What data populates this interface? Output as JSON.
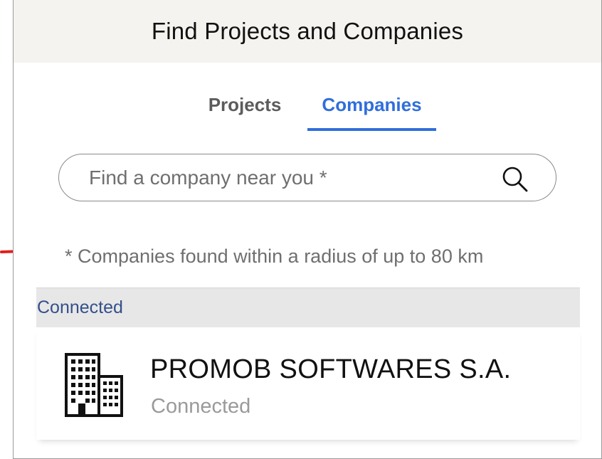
{
  "header": {
    "title": "Find Projects and Companies"
  },
  "tabs": [
    {
      "label": "Projects",
      "active": false
    },
    {
      "label": "Companies",
      "active": true
    }
  ],
  "search": {
    "placeholder": "Find a company near you *",
    "value": ""
  },
  "note": "* Companies found within a radius of up to 80 km",
  "section": {
    "label": "Connected"
  },
  "company": {
    "name": "PROMOB SOFTWARES S.A.",
    "status": "Connected",
    "icon": "building-icon"
  },
  "colors": {
    "accent": "#2f6fdc",
    "annotation_arrow": "#e0201b",
    "header_bg": "#f5f3ef",
    "section_bg": "#e7e7e7"
  }
}
